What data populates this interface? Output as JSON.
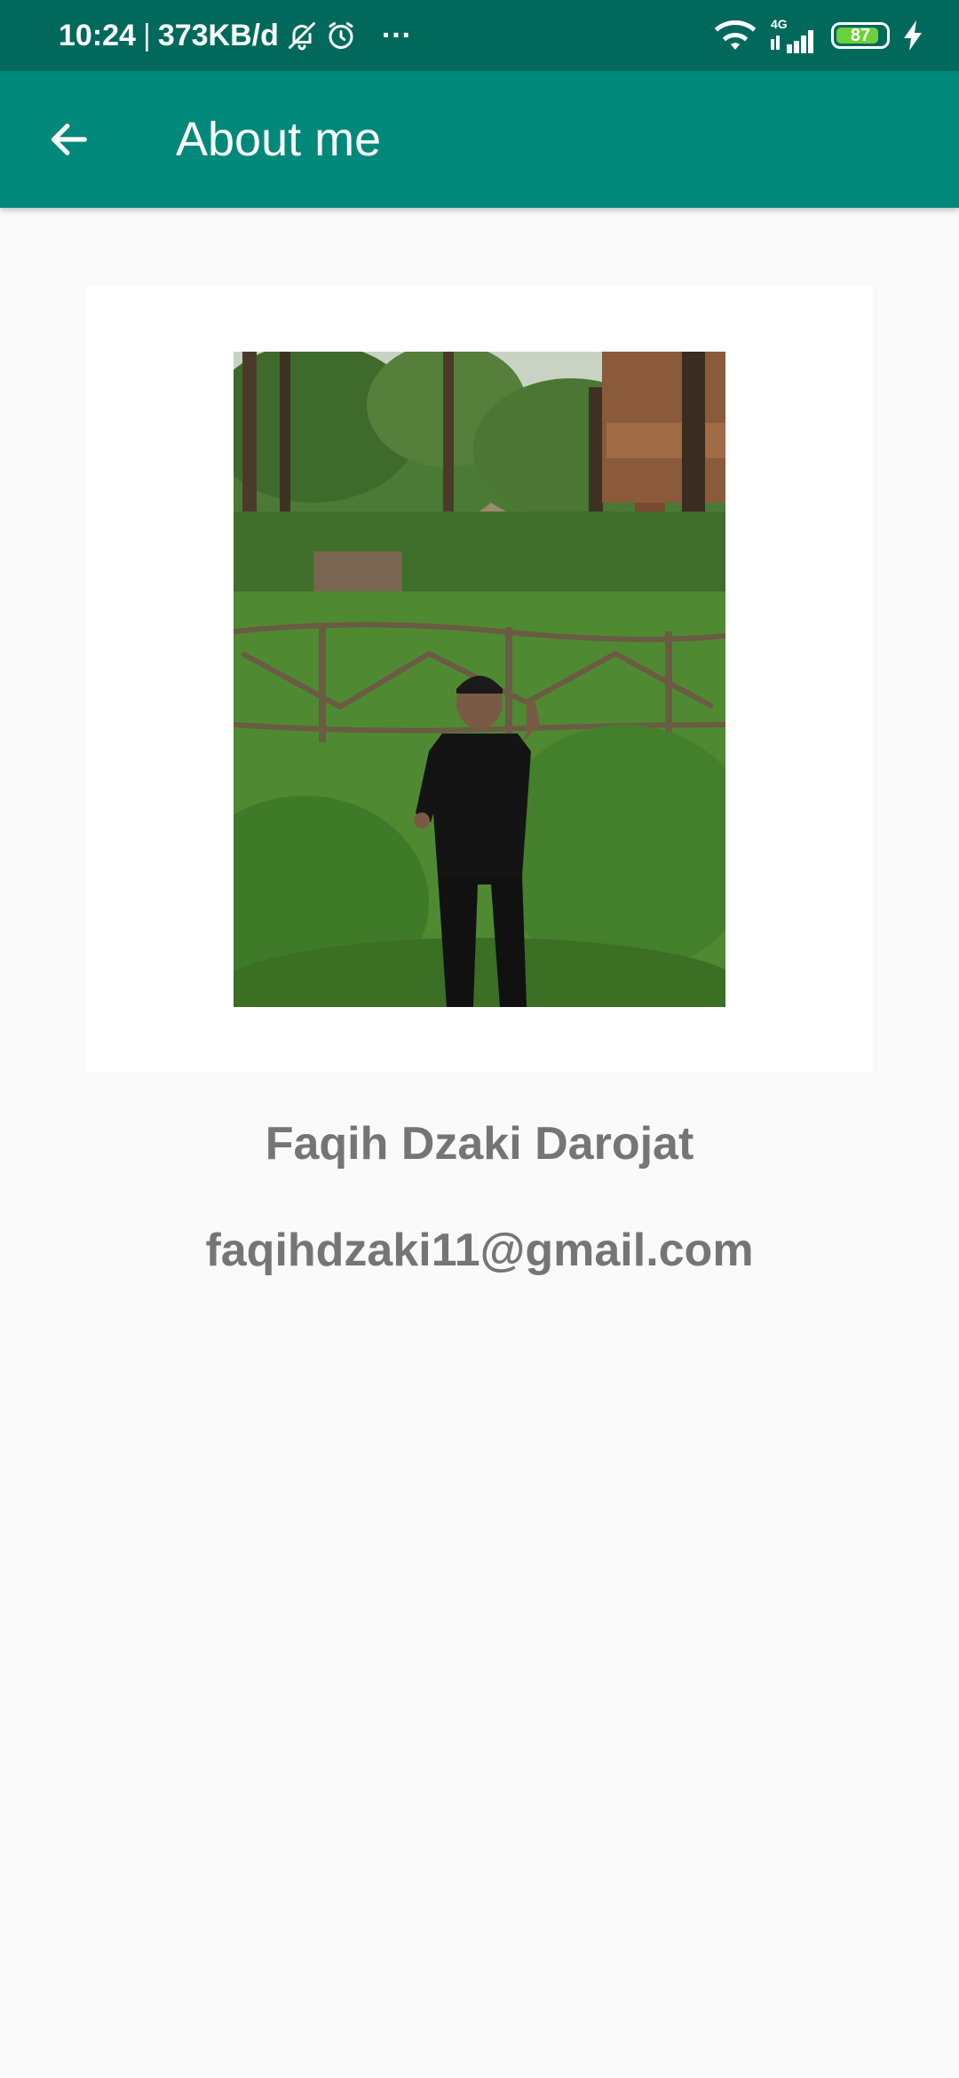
{
  "status_bar": {
    "time": "10:24",
    "separator": "|",
    "net_speed": "373KB/d",
    "more": "···",
    "network_type": "4G",
    "battery_level": "87",
    "battery_percent": 87
  },
  "app_bar": {
    "title": "About me"
  },
  "profile": {
    "name": "Faqih Dzaki Darojat",
    "email": "faqihdzaki11@gmail.com"
  },
  "colors": {
    "status_bar": "#00695c",
    "app_bar": "#00897b",
    "text_secondary": "#757575"
  }
}
